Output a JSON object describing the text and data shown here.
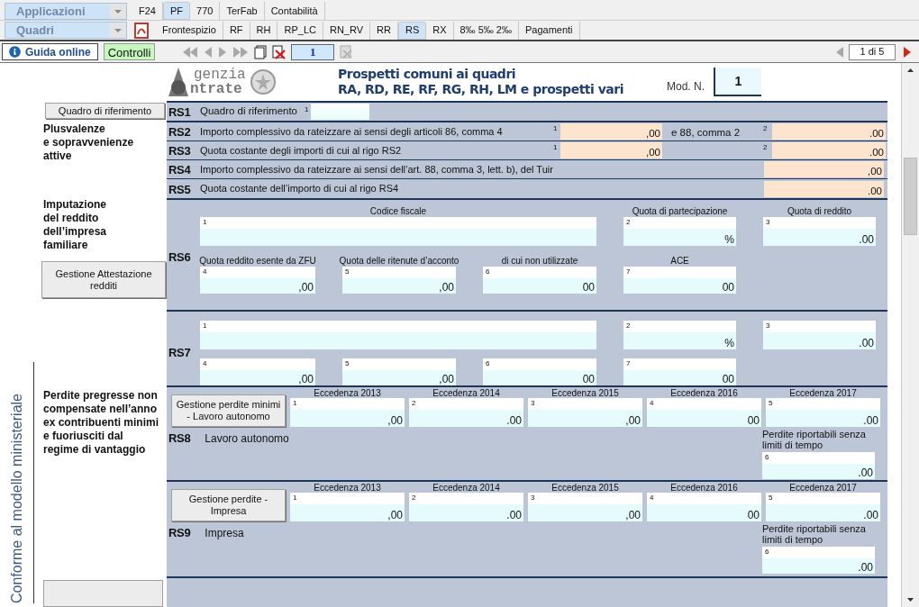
{
  "selectors": [
    {
      "label": "Applicazioni"
    },
    {
      "label": "Quadri"
    }
  ],
  "app_tabs": [
    {
      "label": "F24",
      "selected": false
    },
    {
      "label": "PF",
      "selected": true
    },
    {
      "label": "770",
      "selected": false
    },
    {
      "label": "TerFab",
      "selected": false
    },
    {
      "label": "Contabilità",
      "selected": false
    }
  ],
  "quadri_tabs": [
    {
      "label": "Frontespizio",
      "selected": false
    },
    {
      "label": "RF",
      "selected": false
    },
    {
      "label": "RH",
      "selected": false
    },
    {
      "label": "RP_LC",
      "selected": false
    },
    {
      "label": "RN_RV",
      "selected": false
    },
    {
      "label": "RR",
      "selected": false
    },
    {
      "label": "RS",
      "selected": true
    },
    {
      "label": "RX",
      "selected": false
    },
    {
      "label": "8‰ 5‰ 2‰",
      "selected": false
    },
    {
      "label": "Pagamenti",
      "selected": false
    }
  ],
  "toolbar": {
    "guide_button": "Guida online",
    "check_button": "Controlli",
    "page_field": "1",
    "pager": "1 di 5"
  },
  "side_text": "Conforme al modello ministeriale",
  "header": {
    "logo_top": "genzia",
    "logo_bottom": "ntrate",
    "title_lines": [
      "Prospetti comuni ai quadri",
      "RA, RD, RE, RF, RG, RH, LM e prospetti vari"
    ],
    "mod_label": "Mod. N.",
    "mod_value": "1"
  },
  "sections": [
    {
      "kind": "reference",
      "button": "Quadro di riferimento",
      "code": "RS1",
      "label": "Quadro di riferimento",
      "field": {
        "num": "1"
      }
    },
    {
      "kind": "rows",
      "title_lines": [
        "Plusvalenze",
        "e sopravvenienze",
        "attive"
      ],
      "rows": [
        {
          "code": "RS2",
          "label": "Importo complessivo da rateizzare ai sensi degli articoli 86, comma 4",
          "middle": "e 88, comma 2",
          "fields": [
            {
              "num": "1",
              "value": ",00"
            },
            {
              "num": "2",
              "value": ".00"
            }
          ]
        },
        {
          "code": "RS3",
          "label": "Quota costante degli importi di cui al rigo RS2",
          "fields": [
            {
              "num": "1",
              "value": ",00"
            },
            {
              "num": "2",
              "value": ".00"
            }
          ]
        },
        {
          "code": "RS4",
          "label": "Importo complessivo da rateizzare ai sensi dell’art. 88, comma 3, lett. b), del Tuir",
          "fields": [
            {
              "value": ",00"
            }
          ]
        },
        {
          "code": "RS5",
          "label": "Quota costante dell’importo di cui al rigo RS4",
          "fields": [
            {
              "value": ".00"
            }
          ]
        }
      ]
    },
    {
      "kind": "grid",
      "title_lines": [
        "Imputazione",
        "del reddito",
        "dell’impresa",
        "familiare"
      ],
      "button": "Gestione Attestazione redditi",
      "rows": [
        {
          "code": "RS6",
          "fields": [
            {
              "num": "1",
              "header": "Codice fiscale"
            },
            {
              "num": "2",
              "header": "Quota di partecipazione",
              "value": "%"
            },
            {
              "num": "3",
              "header": "Quota di reddito",
              "value": ".00"
            },
            {
              "num": "4",
              "header": "Quota reddito esente da ZFU",
              "value": ",00"
            },
            {
              "num": "5",
              "header": "Quota delle ritenute d’acconto",
              "value": ",00"
            },
            {
              "num": "6",
              "header": "di cui non utilizzate",
              "value": "00"
            },
            {
              "num": "7",
              "header": "ACE",
              "value": "00"
            }
          ]
        },
        {
          "code": "RS7",
          "fields": [
            {
              "num": "1"
            },
            {
              "num": "2",
              "value": "%"
            },
            {
              "num": "3",
              "value": ".00"
            },
            {
              "num": "4",
              "value": ",00"
            },
            {
              "num": "5",
              "value": ",00"
            },
            {
              "num": "6",
              "value": "00"
            },
            {
              "num": "7",
              "value": "00"
            }
          ]
        }
      ]
    },
    {
      "kind": "losses",
      "title_lines": [
        "Perdite pregresse non",
        "compensate nell’anno",
        "ex contribuenti minimi",
        "e fuoriusciti dal",
        "regime di vantaggio"
      ],
      "rows": [
        {
          "code": "RS8",
          "label": "Lavoro autonomo",
          "button": "Gestione perdite minimi - Lavoro autonomo",
          "fields": [
            {
              "num": "1",
              "header": "Eccedenza 2013",
              "value": ",00"
            },
            {
              "num": "2",
              "header": "Eccedenza 2014",
              "value": ".00"
            },
            {
              "num": "3",
              "header": "Eccedenza 2015",
              "value": ",00"
            },
            {
              "num": "4",
              "header": "Eccedenza 2016",
              "value": "00"
            },
            {
              "num": "5",
              "header": "Eccedenza 2017",
              "value": ".00"
            },
            {
              "num": "6",
              "header": "Perdite riportabili senza limiti di tempo",
              "value": ".00"
            }
          ]
        },
        {
          "code": "RS9",
          "label": "Impresa",
          "button": "Gestione perdite - Impresa",
          "fields": [
            {
              "num": "1",
              "header": "Eccedenza 2013",
              "value": ",00"
            },
            {
              "num": "2",
              "header": "Eccedenza 2014",
              "value": ".00"
            },
            {
              "num": "3",
              "header": "Eccedenza 2015",
              "value": ",00"
            },
            {
              "num": "4",
              "header": "Eccedenza 2016",
              "value": "00"
            },
            {
              "num": "5",
              "header": "Eccedenza 2017",
              "value": ".00"
            },
            {
              "num": "6",
              "header": "Perdite riportabili senza limiti di tempo",
              "value": ".00"
            }
          ]
        }
      ]
    }
  ]
}
